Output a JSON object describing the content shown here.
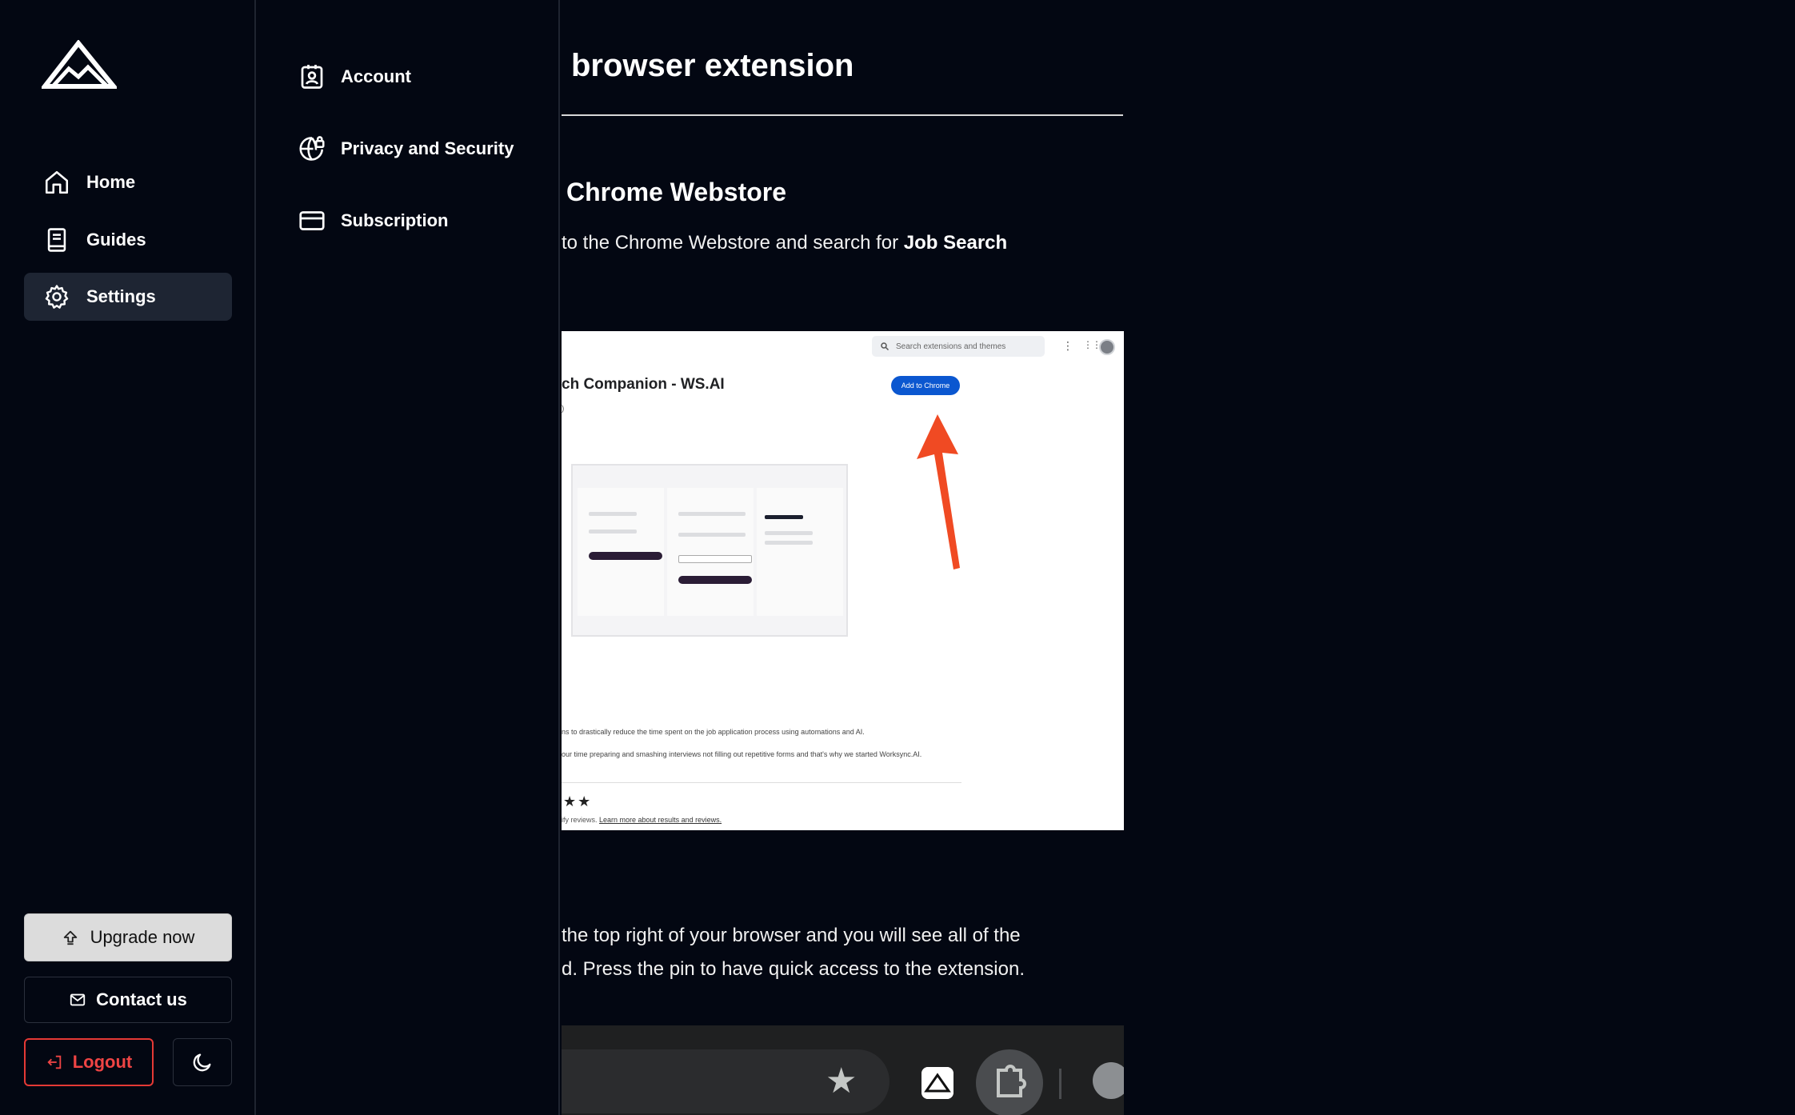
{
  "sidebar": {
    "logo_icon": "mountain-logo",
    "nav": [
      {
        "label": "Home",
        "icon": "home-icon"
      },
      {
        "label": "Guides",
        "icon": "book-icon"
      },
      {
        "label": "Settings",
        "icon": "gear-icon",
        "active": true
      }
    ],
    "upgrade_label": "Upgrade now",
    "contact_label": "Contact us",
    "logout_label": "Logout",
    "theme_icon": "moon-icon"
  },
  "settings_menu": {
    "items": [
      {
        "label": "Account",
        "icon": "id-card-icon"
      },
      {
        "label": "Privacy and Security",
        "icon": "globe-lock-icon"
      },
      {
        "label": "Subscription",
        "icon": "credit-card-icon"
      }
    ]
  },
  "article": {
    "title": "browser extension",
    "step1_heading": "Chrome Webstore",
    "step1_text_before": "to the Chrome Webstore and search for ",
    "step1_text_bold": "Job Search",
    "step2_line1": "the top right of your browser and you will see all of the",
    "step2_line2": "d. Press the pin to have quick access to the extension.",
    "webstore_screenshot": {
      "search_placeholder": "Search extensions and themes",
      "heading": "ch Companion - WS.AI",
      "sub": ")",
      "add_button": "Add to Chrome",
      "line1": "ns to drastically reduce the time spent on the job application process using automations and AI.",
      "line2": "our time preparing and smashing interviews not filling out repetitive forms and that's why we started Worksync.AI.",
      "stars": "★★",
      "reviews_prefix": "ify reviews. ",
      "reviews_link": "Learn more about results and reviews."
    }
  },
  "colors": {
    "background": "#030712",
    "active_nav": "#1e2533",
    "logout": "#ef4444",
    "chrome_blue": "#0b57d0",
    "arrow": "#f04a23"
  }
}
